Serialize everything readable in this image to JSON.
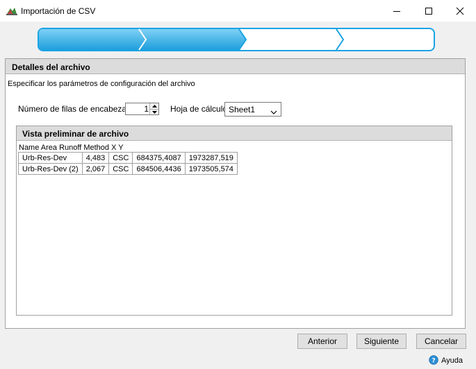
{
  "window": {
    "title": "Importación de CSV",
    "icon": "csv-import-icon"
  },
  "wizard": {
    "total_steps": 4,
    "current_step": 2,
    "accent": "#1fa3e0",
    "inactive": "#ffffff"
  },
  "section": {
    "title": "Detalles del archivo",
    "description": "Especificar los parámetros de configuración del archivo"
  },
  "form": {
    "header_rows_label": "Número de filas de encabezado",
    "header_rows_value": "1",
    "sheet_label": "Hoja de cálculo",
    "sheet_value": "Sheet1"
  },
  "preview": {
    "title": "Vista preliminar de archivo",
    "column_header": "Name Area Runoff Method X Y",
    "rows": [
      [
        "Urb-Res-Dev",
        "4,483",
        "CSC",
        "684375,4087",
        "1973287,519"
      ],
      [
        "Urb-Res-Dev (2)",
        "2,067",
        "CSC",
        "684506,4436",
        "1973505,574"
      ]
    ]
  },
  "buttons": {
    "previous": "Anterior",
    "next": "Siguiente",
    "cancel": "Cancelar"
  },
  "help": {
    "label": "Ayuda"
  }
}
